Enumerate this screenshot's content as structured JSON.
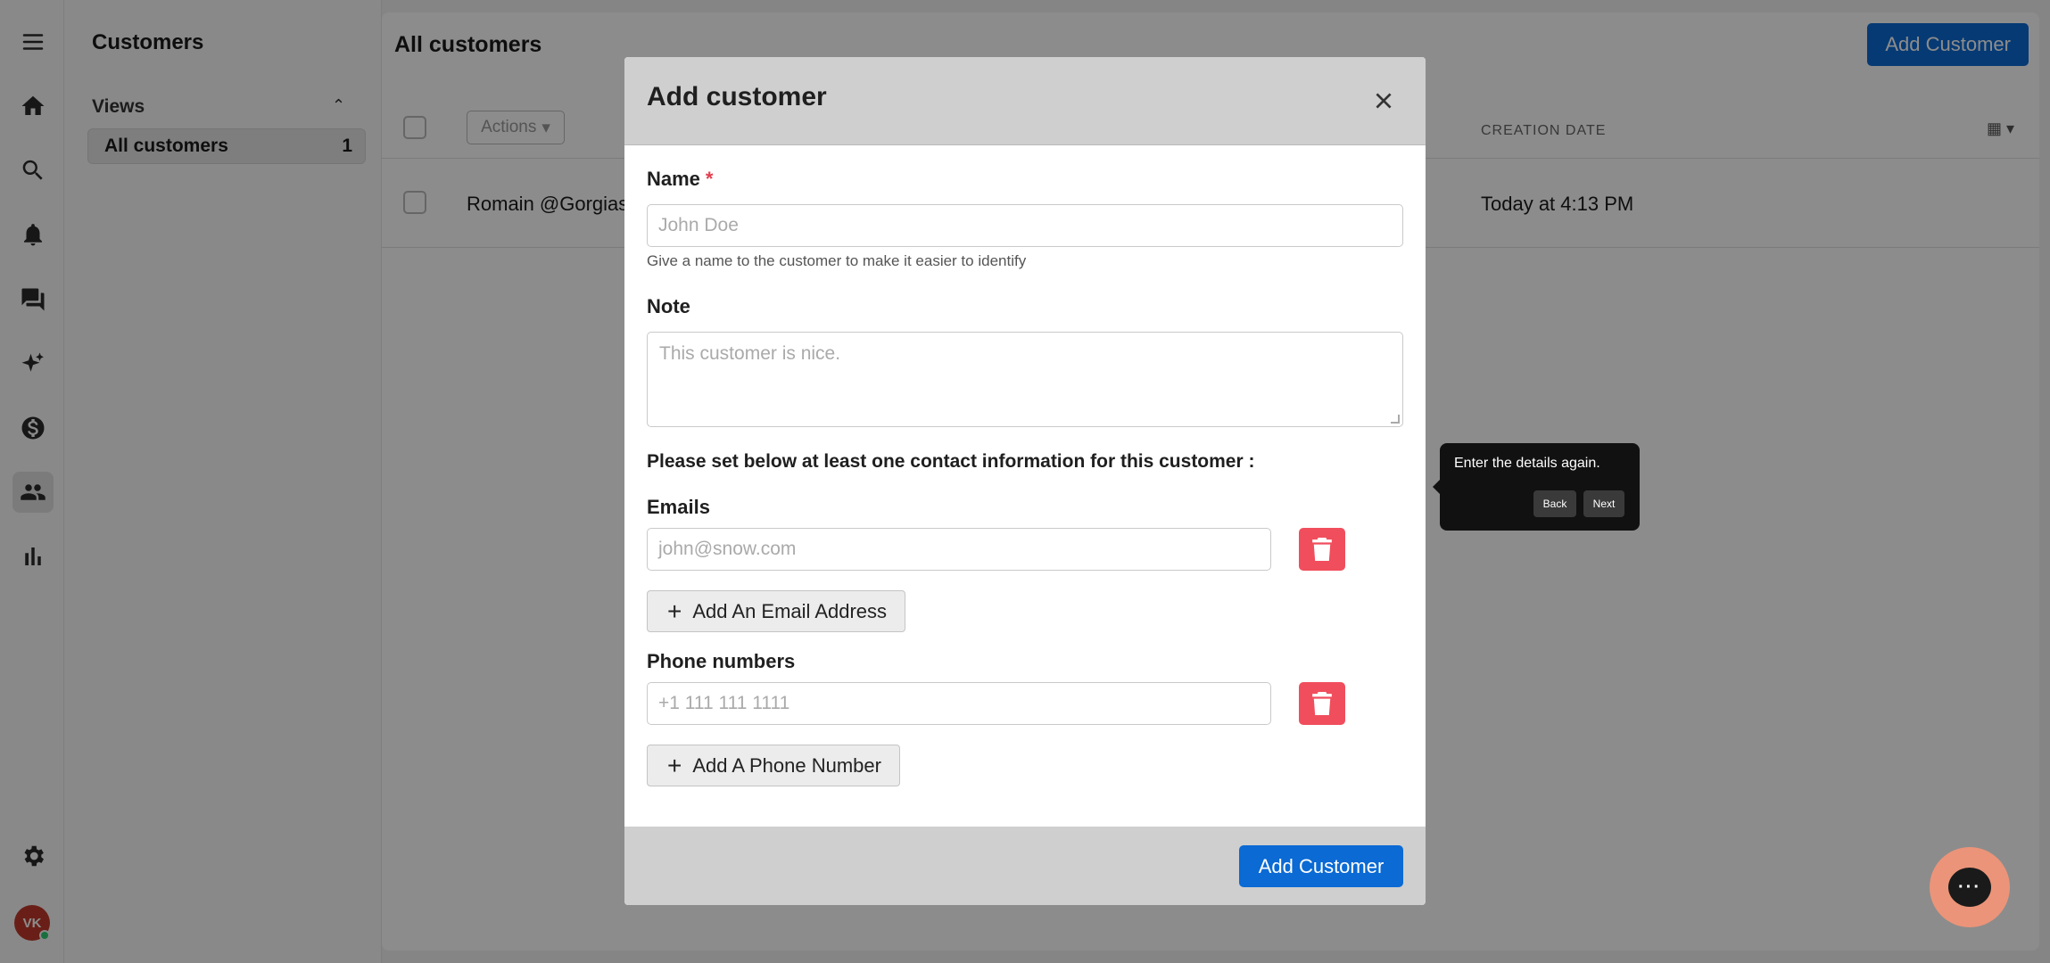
{
  "rail": {
    "items": [
      "menu-icon",
      "home-icon",
      "search-icon",
      "bell-icon",
      "chat-icon",
      "sparkle-icon",
      "dollar-icon",
      "users-icon",
      "chart-icon"
    ],
    "active": "users-icon",
    "settings_icon": "gear-icon",
    "avatar_initials": "VK"
  },
  "sidebar": {
    "title": "Customers",
    "views_label": "Views",
    "items": [
      {
        "label": "All customers",
        "count": "1"
      }
    ]
  },
  "main": {
    "title": "All customers",
    "add_button": "Add Customer",
    "actions_label": "Actions",
    "columns": {
      "creation_date": "CREATION DATE"
    },
    "rows": [
      {
        "name": "Romain @Gorgias",
        "date": "Today at 4:13 PM"
      }
    ]
  },
  "modal": {
    "title": "Add customer",
    "name_label": "Name",
    "required_mark": "*",
    "name_placeholder": "John Doe",
    "name_help": "Give a name to the customer to make it easier to identify",
    "note_label": "Note",
    "note_placeholder": "This customer is nice.",
    "contact_heading": "Please set below at least one contact information for this customer :",
    "emails_label": "Emails",
    "email_placeholder": "john@snow.com",
    "add_email": "Add An Email Address",
    "phones_label": "Phone numbers",
    "phone_placeholder": "+1 111 111 1111",
    "add_phone": "Add A Phone Number",
    "submit": "Add Customer"
  },
  "tooltip": {
    "text": "Enter the details again.",
    "back": "Back",
    "next": "Next"
  },
  "colors": {
    "primary": "#0b6ad4",
    "danger": "#f04e5d",
    "chat": "#eb9479"
  }
}
